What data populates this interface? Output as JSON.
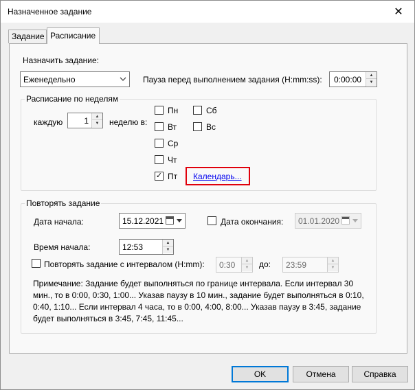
{
  "window": {
    "title": "Назначенное задание",
    "close_glyph": "✕"
  },
  "tabs": [
    {
      "label": "Задание"
    },
    {
      "label": "Расписание"
    }
  ],
  "schedule": {
    "assign_label": "Назначить задание:",
    "assign_value": "Еженедельно",
    "pause_label": "Пауза перед выполнением задания (H:mm:ss):",
    "pause_value": "0:00:00"
  },
  "weekly": {
    "group_title": "Расписание по неделям",
    "every_label": "каждую",
    "every_value": "1",
    "week_label": "неделю в:",
    "days": [
      {
        "label": "Пн",
        "checked": false
      },
      {
        "label": "Вт",
        "checked": false
      },
      {
        "label": "Ср",
        "checked": false
      },
      {
        "label": "Чт",
        "checked": false
      },
      {
        "label": "Пт",
        "checked": true
      },
      {
        "label": "Сб",
        "checked": false
      },
      {
        "label": "Вс",
        "checked": false
      }
    ],
    "calendar_link": "Календарь..."
  },
  "repeat": {
    "group_title": "Повторять задание",
    "start_date_label": "Дата начала:",
    "start_date_value": "15.12.2021",
    "end_date_label": "Дата окончания:",
    "end_date_value": "01.01.2020",
    "start_time_label": "Время начала:",
    "start_time_value": "12:53",
    "interval_label": "Повторять задание с интервалом (H:mm):",
    "interval_value": "0:30",
    "to_label": "до:",
    "to_value": "23:59",
    "note": "Примечание: Задание будет выполняться по границе интервала. Если интервал 30 мин., то в 0:00, 0:30, 1:00... Указав паузу в 10 мин., задание будет выполняться в 0:10, 0:40, 1:10... Если интервал 4 часа, то в 0:00, 4:00, 8:00... Указав паузу в 3:45, задание будет выполняться в 3:45, 7:45, 11:45..."
  },
  "buttons": {
    "ok": "OK",
    "cancel": "Отмена",
    "help": "Справка"
  },
  "icons": {
    "combo_arrow": "chevron-down-icon",
    "calendar": "calendar-icon",
    "check": "✓"
  },
  "colors": {
    "highlight": "#e0000b",
    "link": "#0000ee",
    "default_button": "#0078d7"
  }
}
